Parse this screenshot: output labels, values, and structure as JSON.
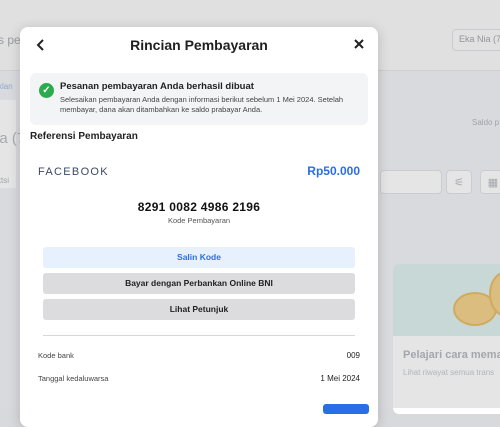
{
  "background": {
    "page_title_fragment": "s pe",
    "user_chip": "Eka Nia (7",
    "tab_fragment": "klan",
    "big_fragment": "ia (7",
    "row_fragment": "ktsi",
    "saldo_fragment": "Saldo p",
    "promo_title": "Pelajari cara memar",
    "promo_sub": "Lihat riwayat semua trans"
  },
  "modal": {
    "title": "Rincian Pembayaran",
    "back_icon": "chevron-left-icon",
    "close_icon": "close-icon",
    "alert": {
      "title": "Pesanan pembayaran Anda berhasil dibuat",
      "text": "Selesaikan pembayaran Anda dengan informasi berikut sebelum 1 Mei 2024. Setelah membayar, dana akan ditambahkan ke saldo prabayar Anda."
    },
    "section_title": "Referensi Pembayaran",
    "merchant": "FACEBOOK",
    "amount": "Rp50.000",
    "payment_code": "8291 0082 4986 2196",
    "payment_code_label": "Kode Pembayaran",
    "buttons": {
      "copy": "Salin Kode",
      "bank": "Bayar dengan Perbankan Online BNI",
      "guide": "Lihat Petunjuk"
    },
    "details": [
      {
        "label": "Kode bank",
        "value": "009"
      },
      {
        "label": "Tanggal kedaluwarsa",
        "value": "1 Mei 2024"
      }
    ]
  },
  "colors": {
    "accent": "#2a6ee6",
    "success": "#2bab4d"
  }
}
